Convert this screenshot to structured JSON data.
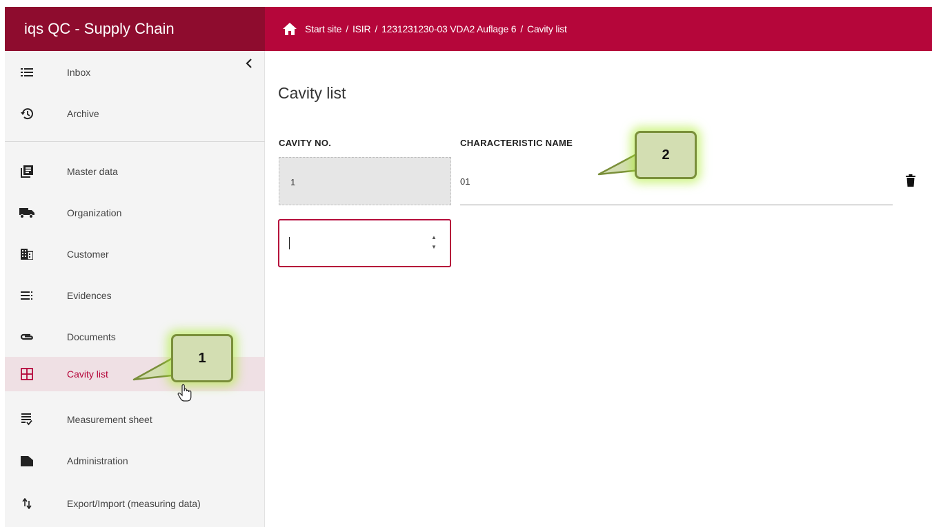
{
  "app": {
    "title": "iqs QC - Supply Chain"
  },
  "breadcrumb": {
    "items": [
      "Start site",
      "ISIR",
      "1231231230-03 VDA2 Auflage 6",
      "Cavity list"
    ],
    "separator": "/"
  },
  "sidebar": {
    "items": [
      {
        "label": "Inbox",
        "icon": "inbox-list-icon"
      },
      {
        "label": "Archive",
        "icon": "history-icon"
      },
      {
        "label": "Master data",
        "icon": "library-books-icon"
      },
      {
        "label": "Organization",
        "icon": "truck-icon"
      },
      {
        "label": "Customer",
        "icon": "building-icon"
      },
      {
        "label": "Evidences",
        "icon": "notes-list-icon"
      },
      {
        "label": "Documents",
        "icon": "paperclip-icon"
      },
      {
        "label": "Cavity list",
        "icon": "grid-icon",
        "active": true
      },
      {
        "label": "Measurement sheet",
        "icon": "checklist-icon"
      },
      {
        "label": "Administration",
        "icon": "folder-icon"
      },
      {
        "label": "Export/Import (measuring data)",
        "icon": "import-export-icon"
      }
    ]
  },
  "main": {
    "title": "Cavity list",
    "columns": {
      "cavity_no": "CAVITY NO.",
      "characteristic_name": "CHARACTERISTIC NAME"
    },
    "rows": [
      {
        "cavity_no": "1",
        "characteristic_name": "01"
      }
    ],
    "new_cavity_value": ""
  },
  "callouts": [
    {
      "label": "1"
    },
    {
      "label": "2"
    }
  ],
  "colors": {
    "brand_dark": "#8e0c2e",
    "brand": "#b5063a",
    "callout_fill": "#d3deb2",
    "active_bg": "#efe0e4"
  }
}
